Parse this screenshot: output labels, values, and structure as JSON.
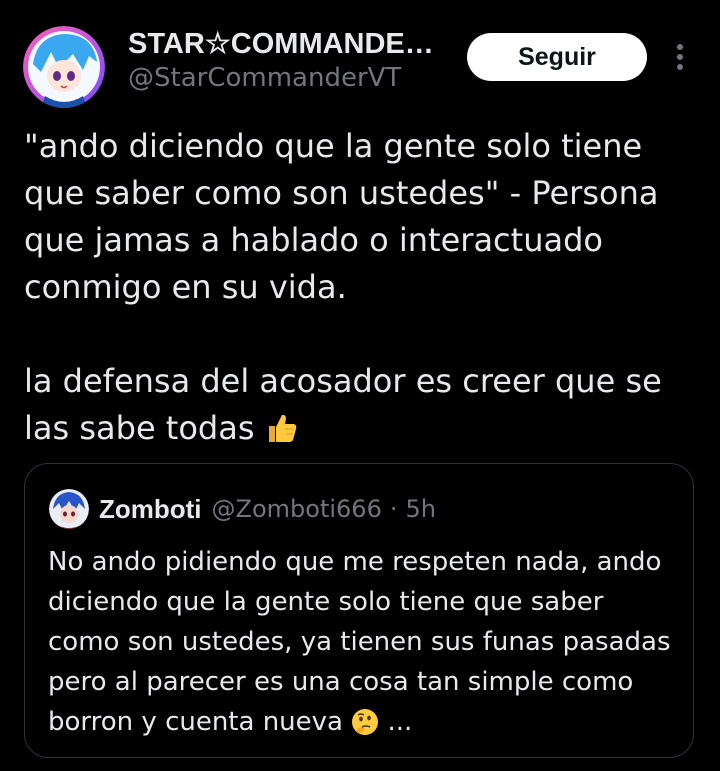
{
  "author": {
    "display_name": "STAR☆COMMANDE…",
    "handle": "@StarCommanderVT"
  },
  "follow_button": {
    "label": "Seguir"
  },
  "more_icon": "more-vertical-icon",
  "tweet": {
    "text_part1": "\"ando diciendo que la gente solo tiene\nque saber como son ustedes\" - Persona\nque jamas a hablado o interactuado\nconmigo en su vida.\n\nla defensa del acosador es creer que se\nlas sabe todas ",
    "emoji": "thumbs-up-icon"
  },
  "quoted": {
    "display_name": "Zomboti",
    "handle": "@Zomboti666",
    "separator": "·",
    "time": "5h",
    "text": "No ando pidiendo que me respeten nada, ando diciendo que la gente solo tiene que saber como son ustedes, ya tienen sus funas pasadas pero al parecer es una cosa tan simple como borron y cuenta nueva ",
    "emoji": "thinking-face-icon",
    "ellipsis": " ..."
  },
  "colors": {
    "background": "#000000",
    "text": "#e7e9ea",
    "secondary_text": "#71767b",
    "border": "#2f3336",
    "button_bg": "#ffffff"
  }
}
